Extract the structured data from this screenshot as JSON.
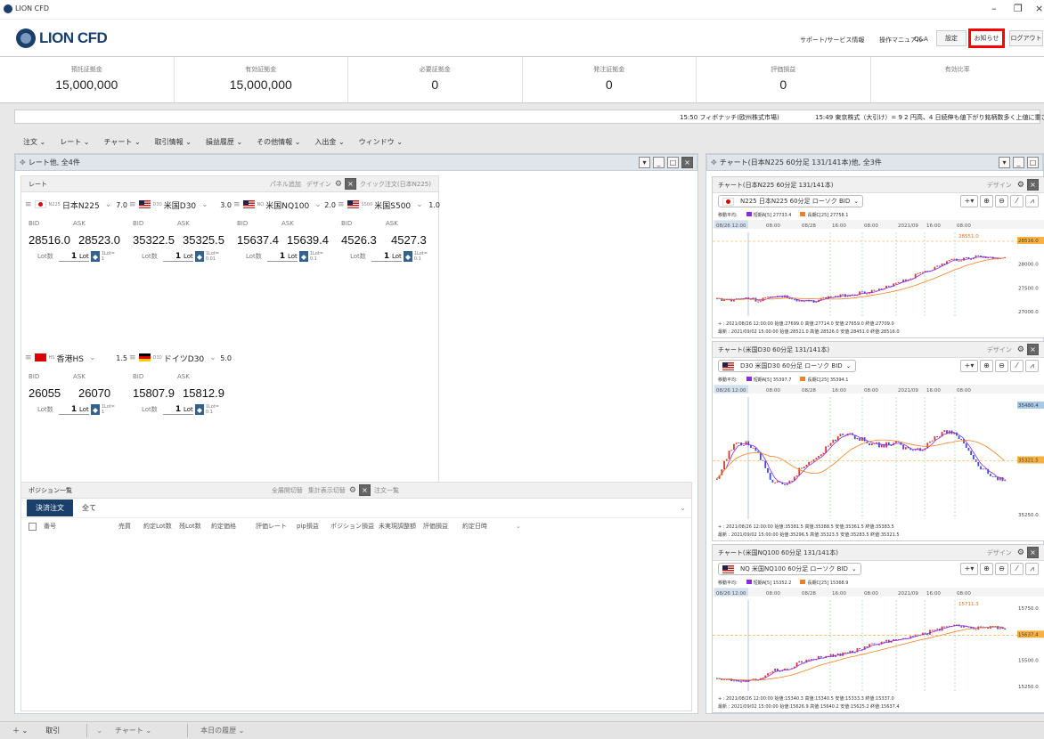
{
  "window": {
    "title": "LION CFD"
  },
  "brand": {
    "logo_text": "LION CFD"
  },
  "header_links": [
    "サポート/サービス情報",
    "操作マニュアル",
    "Q&A"
  ],
  "header_buttons": {
    "settings": "設定",
    "notice": "お知らせ",
    "logout": "ログアウト"
  },
  "account": [
    {
      "label": "預託証拠金",
      "value": "15,000,000"
    },
    {
      "label": "有効証拠金",
      "value": "15,000,000"
    },
    {
      "label": "必要証拠金",
      "value": "0"
    },
    {
      "label": "発注証拠金",
      "value": "0"
    },
    {
      "label": "評価損益",
      "value": "0"
    },
    {
      "label": "有効比率",
      "value": ""
    }
  ],
  "news": {
    "item1": "15:50 フィボナッチ(欧州株式市場)",
    "item2": "15:49 東京株式（大引け）= 9 2 円高、4 日続伸も値下がり銘柄数多く上値に重さ"
  },
  "menu": [
    "注文",
    "レート",
    "チャート",
    "取引情報",
    "損益履歴",
    "その他情報",
    "入出金",
    "ウィンドウ"
  ],
  "rate_panel": {
    "title": "レート他, 全4件",
    "sub_title": "レート",
    "sub_actions": {
      "add_panel": "パネル追加",
      "design": "デザイン",
      "quick": "クイック注文(日本N225)"
    },
    "bid_label": "BID",
    "ask_label": "ASK",
    "lot_label": "Lot数",
    "lot_value": "1",
    "lot_unit": "Lot",
    "tiles": [
      {
        "name": "日本N225",
        "code": "N225",
        "spread": "7.0",
        "bid": "28516.0",
        "ask": "28523.0",
        "lot_ratio": "1",
        "flag": "jp"
      },
      {
        "name": "米国D30",
        "code": "D30",
        "spread": "3.0",
        "bid": "35322.5",
        "ask": "35325.5",
        "lot_ratio": "0.01",
        "flag": "us"
      },
      {
        "name": "米国NQ100",
        "code": "NQ",
        "spread": "2.0",
        "bid": "15637.4",
        "ask": "15639.4",
        "lot_ratio": "0.1",
        "flag": "us"
      },
      {
        "name": "米国S500",
        "code": "S500",
        "spread": "1.0",
        "bid": "4526.3",
        "ask": "4527.3",
        "lot_ratio": "0.1",
        "flag": "us"
      },
      {
        "name": "香港HS",
        "code": "HS",
        "spread": "1.5",
        "bid": "26055",
        "ask": "26070",
        "lot_ratio": "1",
        "flag": "hk"
      },
      {
        "name": "ドイツD30",
        "code": "D30",
        "spread": "5.0",
        "bid": "15807.9",
        "ask": "15812.9",
        "lot_ratio": "0.1",
        "flag": "de"
      }
    ]
  },
  "positions": {
    "title": "ポジション一覧",
    "actions": {
      "expand": "全展開切替",
      "sum": "集計表示切替",
      "orders": "注文一覧"
    },
    "settle_button": "決済注文",
    "filter": "全て",
    "columns": [
      "番号",
      "売買",
      "約定Lot数",
      "残Lot数",
      "約定価格",
      "評価レート",
      "pip損益",
      "ポジション損益",
      "未実現調整額",
      "評価損益",
      "約定日時"
    ]
  },
  "chart_panel": {
    "title": "チャート(日本N225 60分足 131/141本)他, 全3件"
  },
  "charts": [
    {
      "title": "チャート(日本N225 60分足 131/141本)",
      "symbol": "N225 日本N225 60分足 ローソク BID",
      "ma_label": "移動平均:",
      "ma1": "短期A[5] 27733.4",
      "ma2": "長期C[25] 27758.1",
      "dates": [
        "08/26 12:00",
        "08:00",
        "08/28",
        "16:00",
        "08:00",
        "2021/09",
        "16:00",
        "08:00"
      ],
      "yticks": [
        "28516.0",
        "28000.0",
        "27500.0",
        "27000.0"
      ],
      "high_label": "28551.0",
      "info1": "+ : 2021/08/26 12:00:00 始値:27699.0 高値:27714.0 安値:27659.0 終値:27709.0",
      "info2": "最新 : 2021/09/02 15:00:00 始値:28521.0 高値:28526.0 安値:28451.0 終値:28516.0",
      "flag": "jp"
    },
    {
      "title": "チャート(米国D30 60分足 131/141本)",
      "symbol": "D30 米国D30 60分足 ローソク BID",
      "ma_label": "移動平均:",
      "ma1": "短期A[5] 35397.7",
      "ma2": "長期C[25] 35394.1",
      "dates": [
        "08/26 12:00",
        "08:00",
        "08/28",
        "16:00",
        "08:00",
        "2021/09",
        "16:00",
        "08:00"
      ],
      "yticks": [
        "35480.4",
        "35321.5",
        "35250.0"
      ],
      "high_label": "",
      "info1": "+ : 2021/08/26 12:00:00 始値:35381.5 高値:35388.5 安値:35361.5 終値:35383.5",
      "info2": "最新 : 2021/09/02 15:00:00 始値:35296.5 高値:35323.5 安値:35283.5 終値:35321.5",
      "flag": "us"
    },
    {
      "title": "チャート(米国NQ100 60分足 131/141本)",
      "symbol": "NQ 米国NQ100 60分足 ローソク BID",
      "ma_label": "移動平均:",
      "ma1": "短期A[5] 15352.2",
      "ma2": "長期C[25] 15368.9",
      "dates": [
        "08/26 12:00",
        "08:00",
        "08/28",
        "16:00",
        "08:00",
        "2021/09",
        "16:00",
        "08:00"
      ],
      "yticks": [
        "15750.0",
        "15637.4",
        "15500.0",
        "15250.0"
      ],
      "high_label": "15711.3",
      "info1": "+ : 2021/08/26 12:00:00 始値:15340.3 高値:15340.5 安値:15333.3 終値:15337.0",
      "info2": "最新 : 2021/09/02 15:00:00 始値:15626.9 高値:15640.2 安値:15625.2 終値:15637.4",
      "flag": "us"
    }
  ],
  "chart_design": "デザイン",
  "bottom_tabs": [
    "取引",
    "チャート",
    "本日の履歴"
  ],
  "colors": {
    "accent": "#1b3f6b",
    "up": "#e0352b",
    "down": "#3a4ee0",
    "ma1": "#8a2be2",
    "ma2": "#f08020",
    "highlight": "#ff0000"
  }
}
